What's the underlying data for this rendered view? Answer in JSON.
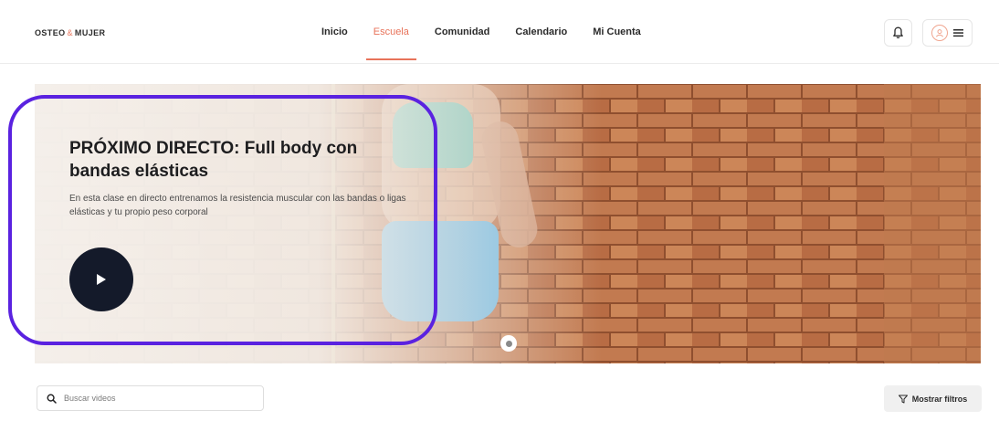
{
  "header": {
    "logo_left": "OSTEO",
    "logo_amp": "&",
    "logo_right": "MUJER",
    "nav": [
      {
        "label": "Inicio",
        "active": false
      },
      {
        "label": "Escuela",
        "active": true
      },
      {
        "label": "Comunidad",
        "active": false
      },
      {
        "label": "Calendario",
        "active": false
      },
      {
        "label": "Mi Cuenta",
        "active": false
      }
    ],
    "icons": {
      "bell": "bell-icon",
      "avatar": "user-avatar-icon",
      "menu": "hamburger-menu-icon"
    },
    "accent": "#e8735a"
  },
  "hero": {
    "title": "PRÓXIMO DIRECTO: Full body con bandas elásticas",
    "description": "En esta clase en directo entrenamos la resistencia muscular con las bandas o ligas elásticas y tu propio peso corporal",
    "play_icon": "play-icon",
    "highlight_color": "#5a22e0",
    "play_button_color": "#141a2a"
  },
  "search": {
    "placeholder": "Buscar videos",
    "value": "",
    "icon": "search-icon"
  },
  "filters": {
    "label": "Mostrar filtros",
    "icon": "filter-icon"
  }
}
